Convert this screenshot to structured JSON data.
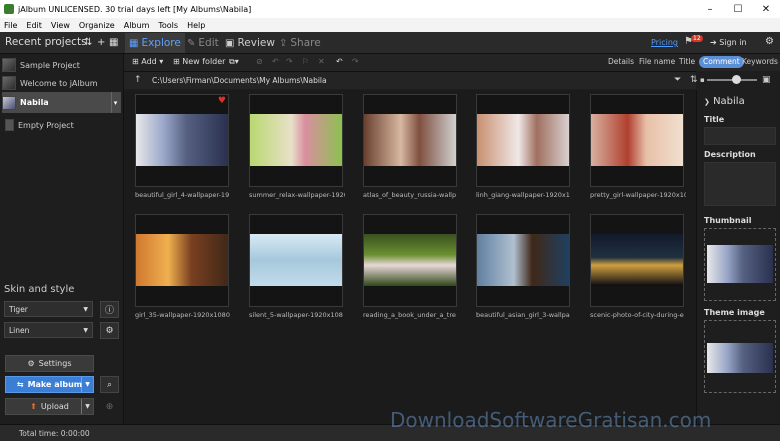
{
  "window": {
    "title": "jAlbum UNLICENSED. 30 trial days left [My Albums\\Nabila]",
    "controls": [
      "–",
      "☐",
      "✕"
    ]
  },
  "menu": [
    "File",
    "Edit",
    "View",
    "Organize",
    "Album",
    "Tools",
    "Help"
  ],
  "toolbar": {
    "recent_projects": "Recent projects",
    "modes": [
      {
        "label": "Explore",
        "glyph": "▦"
      },
      {
        "label": "Edit",
        "glyph": "✎"
      },
      {
        "label": "Review",
        "glyph": "▣"
      },
      {
        "label": "Share",
        "glyph": "⇪"
      }
    ],
    "pricing": "Pricing",
    "notifications": "12",
    "sign_in": "Sign in"
  },
  "sidebar": {
    "projects": [
      {
        "name": "Sample Project"
      },
      {
        "name": "Welcome to jAlbum"
      },
      {
        "name": "Nabila"
      },
      {
        "name": "Empty Project"
      }
    ],
    "skin_title": "Skin and style",
    "skin": "Tiger",
    "style": "Linen",
    "settings": "Settings",
    "make_album": "Make album",
    "upload": "Upload"
  },
  "toolbar2": {
    "add": "Add",
    "new_folder": "New folder",
    "details": "Details",
    "columns": [
      "File name",
      "Title",
      "Comment",
      "Keywords"
    ],
    "active_column": "Comment"
  },
  "path": "C:\\Users\\Firman\\Documents\\My Albums\\Nabila",
  "images": [
    {
      "caption": "beautiful_girl_4-wallpaper-19",
      "favorite": true
    },
    {
      "caption": "summer_relax-wallpaper-1920",
      "favorite": false
    },
    {
      "caption": "atlas_of_beauty_russia-wallp",
      "favorite": false
    },
    {
      "caption": "linh_giang-wallpaper-1920x1",
      "favorite": false
    },
    {
      "caption": "pretty_girl-wallpaper-1920x10",
      "favorite": false
    },
    {
      "caption": "girl_35-wallpaper-1920x1080",
      "favorite": false
    },
    {
      "caption": "silent_5-wallpaper-1920x108",
      "favorite": false
    },
    {
      "caption": "reading_a_book_under_a_tre",
      "favorite": false
    },
    {
      "caption": "beautiful_asian_girl_3-wallpa",
      "favorite": false
    },
    {
      "caption": "scenic-photo-of-city-during-e",
      "favorite": false
    }
  ],
  "right_panel": {
    "title": "Nabila",
    "title_label": "Title",
    "description_label": "Description",
    "thumbnail_label": "Thumbnail",
    "theme_image_label": "Theme image"
  },
  "status": "Total time: 0:00:00",
  "watermark": "DownloadSoftwareGratisan.com"
}
